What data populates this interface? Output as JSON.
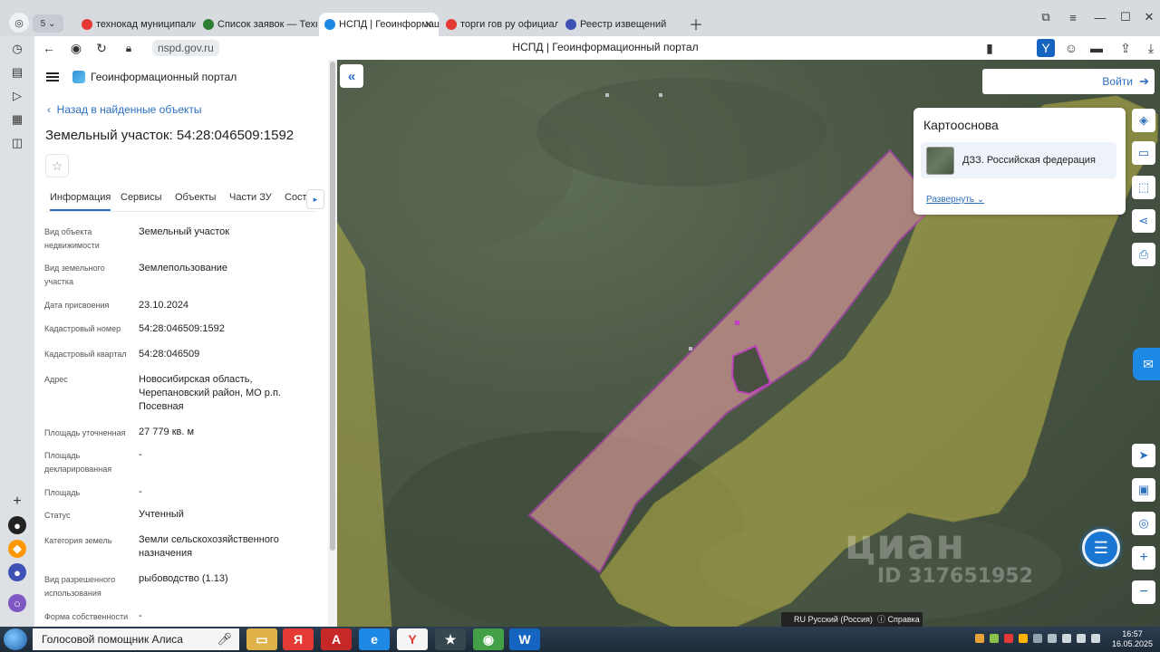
{
  "browser": {
    "tabs": [
      {
        "label": "технокад муниципалитет",
        "favicon_color": "#e53935"
      },
      {
        "label": "Список заявок — ТехноК",
        "favicon_color": "#2e7d32"
      },
      {
        "label": "НСПД | Геоинформаци",
        "favicon_color": "#1e88e5",
        "active": true
      },
      {
        "label": "торги гов ру официальнь",
        "favicon_color": "#e53935"
      },
      {
        "label": "Реестр извещений",
        "favicon_color": "#3f51b5"
      }
    ],
    "tab_count": "5",
    "url": "nspd.gov.ru",
    "page_title": "НСПД | Геоинформационный портал"
  },
  "panel": {
    "portal_name": "Геоинформационный портал",
    "back_label": "Назад в найденные объекты",
    "title": "Земельный участок: 54:28:046509:1592",
    "tabs": [
      "Информация",
      "Сервисы",
      "Объекты",
      "Части ЗУ",
      "Соста"
    ],
    "fields": [
      {
        "label": "Вид объекта недвижимости",
        "value": "Земельный участок"
      },
      {
        "label": "Вид земельного участка",
        "value": "Землепользование"
      },
      {
        "label": "Дата присвоения",
        "value": "23.10.2024"
      },
      {
        "label": "Кадастровый номер",
        "value": "54:28:046509:1592"
      },
      {
        "label": "Кадастровый квартал",
        "value": "54:28:046509"
      },
      {
        "label": "Адрес",
        "value": "Новосибирская область, Черепановский район, МО р.п. Посевная"
      },
      {
        "label": "Площадь уточненная",
        "value": "27 779 кв. м"
      },
      {
        "label": "Площадь декларированная",
        "value": "-"
      },
      {
        "label": "Площадь",
        "value": "-"
      },
      {
        "label": "Статус",
        "value": "Учтенный"
      },
      {
        "label": "Категория земель",
        "value": "Земли сельскохозяйственного назначения"
      },
      {
        "label": "Вид разрешенного использования",
        "value": "рыбоводство (1.13)"
      },
      {
        "label": "Форма собственности",
        "value": "-"
      }
    ]
  },
  "map": {
    "login_label": "Войти",
    "basemap_title": "Картооснова",
    "basemap_item": "ДЗЗ. Российская федерация",
    "expand_label": "Развернуть",
    "watermark": "циан",
    "watermark_id": "ID 317651952",
    "language_bar": "RU Русский (Россия)",
    "help_label": "Справка",
    "colors": {
      "parcel_fill": "#e8a0a0",
      "parcel_stroke": "#c53cc8",
      "zone_fill": "#c9c24a"
    }
  },
  "taskbar": {
    "assistant_label": "Голосовой помощник Алиса",
    "time": "16:57",
    "date": "16.05.2025"
  }
}
